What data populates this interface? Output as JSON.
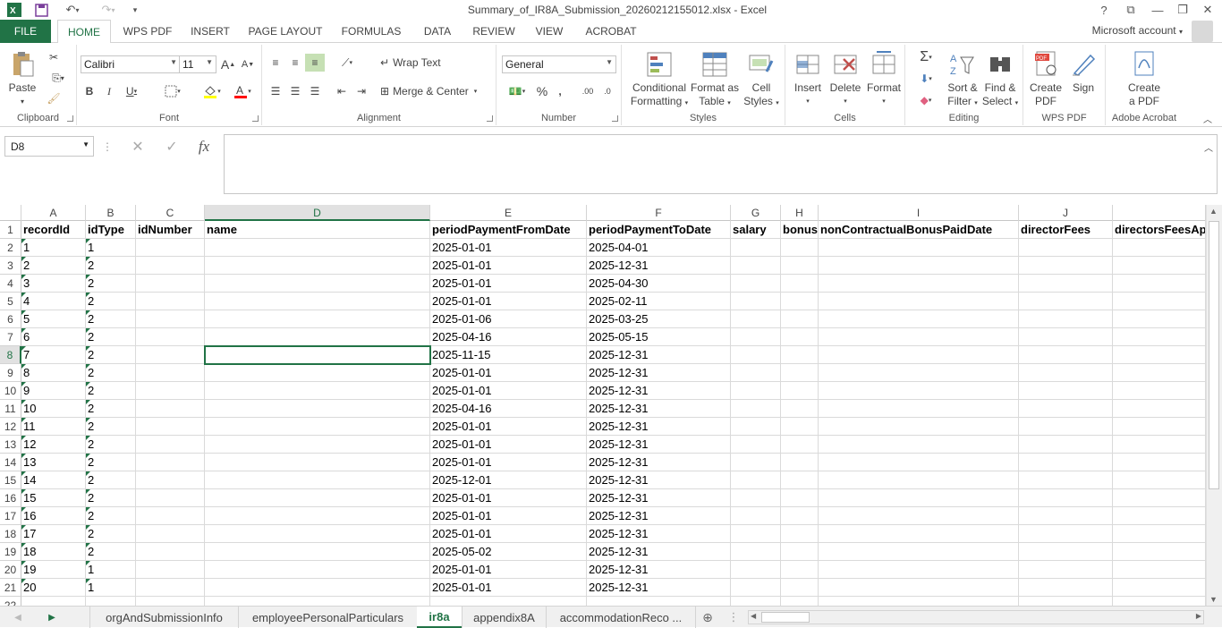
{
  "window": {
    "title": "Summary_of_IR8A_Submission_20260212155012.xlsx - Excel",
    "help": "?",
    "account": "Microsoft account"
  },
  "tabs": [
    "FILE",
    "HOME",
    "WPS PDF",
    "INSERT",
    "PAGE LAYOUT",
    "FORMULAS",
    "DATA",
    "REVIEW",
    "VIEW",
    "ACROBAT"
  ],
  "ribbon": {
    "clipboard": {
      "label": "Clipboard",
      "paste": "Paste"
    },
    "font": {
      "label": "Font",
      "name": "Calibri",
      "size": "11",
      "bold": "B",
      "italic": "I",
      "underline": "U",
      "grow": "A",
      "shrink": "A"
    },
    "alignment": {
      "label": "Alignment",
      "wrap": "Wrap Text",
      "merge": "Merge & Center"
    },
    "number": {
      "label": "Number",
      "format": "General",
      "percent": "%",
      "comma": ",",
      "inc_dec": ".00",
      "dec_dec": ".0"
    },
    "styles": {
      "label": "Styles",
      "conditional_1": "Conditional",
      "conditional_2": "Formatting",
      "format_table_1": "Format as",
      "format_table_2": "Table",
      "cell_styles_1": "Cell",
      "cell_styles_2": "Styles"
    },
    "cells": {
      "label": "Cells",
      "insert": "Insert",
      "delete": "Delete",
      "format": "Format"
    },
    "editing": {
      "label": "Editing",
      "sort_1": "Sort &",
      "sort_2": "Filter",
      "find_1": "Find &",
      "find_2": "Select"
    },
    "wpspdf": {
      "label": "WPS PDF",
      "create_1": "Create",
      "create_2": "PDF",
      "sign": "Sign"
    },
    "acrobat": {
      "label": "Adobe Acrobat",
      "create_1": "Create",
      "create_2": "a PDF"
    }
  },
  "formula_bar": {
    "name_box": "D8",
    "fx": "fx",
    "content": ""
  },
  "columns": [
    "A",
    "B",
    "C",
    "D",
    "E",
    "F",
    "G",
    "H",
    "I",
    "J",
    ""
  ],
  "headers": [
    "recordId",
    "idType",
    "idNumber",
    "name",
    "periodPaymentFromDate",
    "periodPaymentToDate",
    "salary",
    "bonus",
    "nonContractualBonusPaidDate",
    "directorFees",
    "directorsFeesAp"
  ],
  "rows": [
    [
      "1",
      "1",
      "2025-01-01",
      "2025-04-01"
    ],
    [
      "2",
      "2",
      "2025-01-01",
      "2025-12-31"
    ],
    [
      "3",
      "2",
      "2025-01-01",
      "2025-04-30"
    ],
    [
      "4",
      "2",
      "2025-01-01",
      "2025-02-11"
    ],
    [
      "5",
      "2",
      "2025-01-06",
      "2025-03-25"
    ],
    [
      "6",
      "2",
      "2025-04-16",
      "2025-05-15"
    ],
    [
      "7",
      "2",
      "2025-11-15",
      "2025-12-31"
    ],
    [
      "8",
      "2",
      "2025-01-01",
      "2025-12-31"
    ],
    [
      "9",
      "2",
      "2025-01-01",
      "2025-12-31"
    ],
    [
      "10",
      "2",
      "2025-04-16",
      "2025-12-31"
    ],
    [
      "11",
      "2",
      "2025-01-01",
      "2025-12-31"
    ],
    [
      "12",
      "2",
      "2025-01-01",
      "2025-12-31"
    ],
    [
      "13",
      "2",
      "2025-01-01",
      "2025-12-31"
    ],
    [
      "14",
      "2",
      "2025-12-01",
      "2025-12-31"
    ],
    [
      "15",
      "2",
      "2025-01-01",
      "2025-12-31"
    ],
    [
      "16",
      "2",
      "2025-01-01",
      "2025-12-31"
    ],
    [
      "17",
      "2",
      "2025-01-01",
      "2025-12-31"
    ],
    [
      "18",
      "2",
      "2025-05-02",
      "2025-12-31"
    ],
    [
      "19",
      "1",
      "2025-01-01",
      "2025-12-31"
    ],
    [
      "20",
      "1",
      "2025-01-01",
      "2025-12-31"
    ]
  ],
  "sheets": [
    "orgAndSubmissionInfo",
    "employeePersonalParticulars",
    "ir8a",
    "appendix8A",
    "accommodationReco ..."
  ],
  "active_sheet": "ir8a",
  "colors": {
    "excel_green": "#217346",
    "selection": "#217346"
  }
}
